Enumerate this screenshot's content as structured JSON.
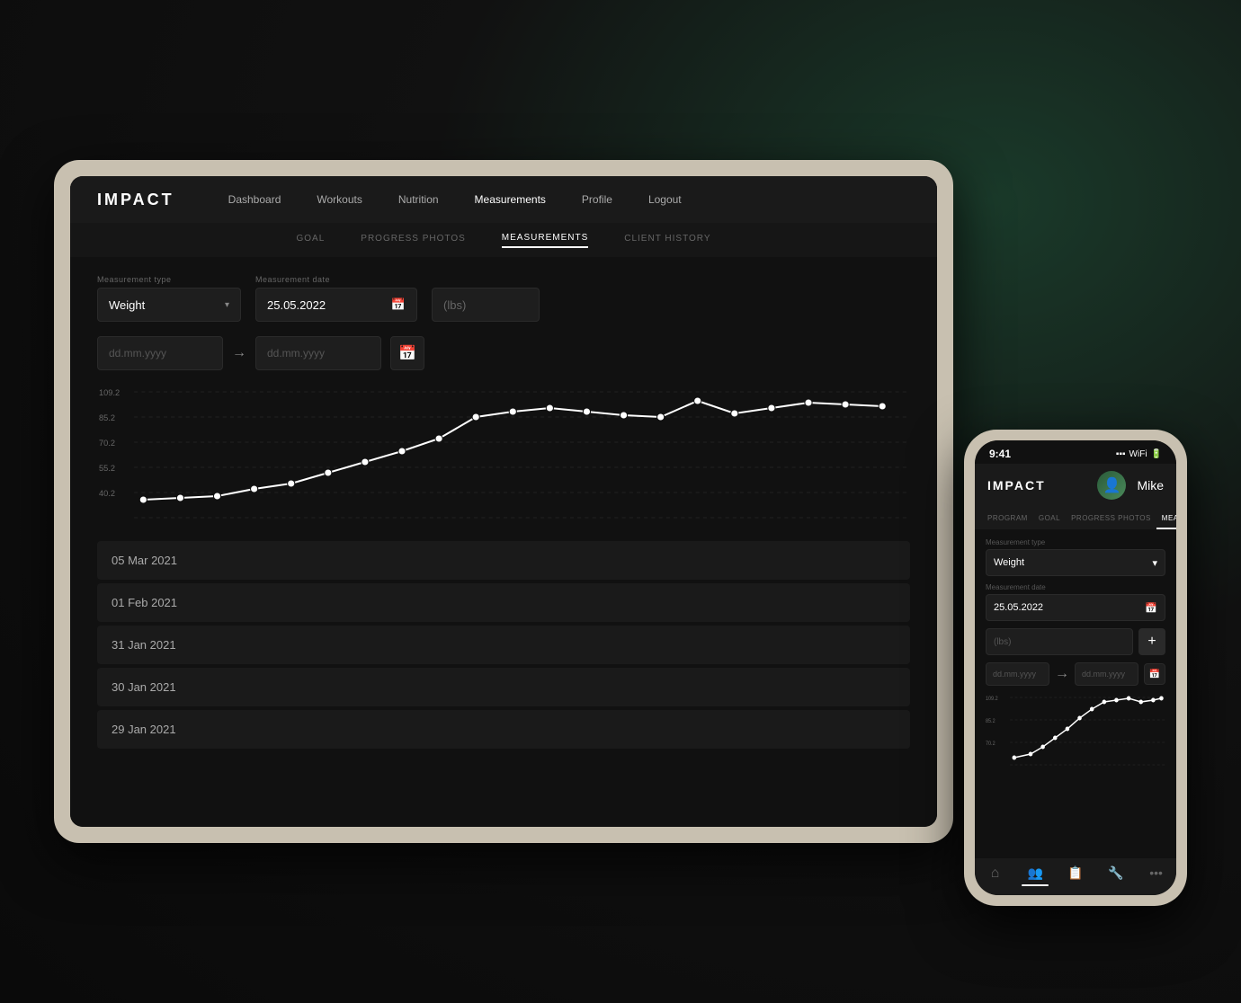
{
  "app": {
    "name": "IMPACT",
    "logo": "IMPACT"
  },
  "tablet": {
    "nav": {
      "items": [
        {
          "label": "Dashboard",
          "active": false
        },
        {
          "label": "Workouts",
          "active": false
        },
        {
          "label": "Nutrition",
          "active": false
        },
        {
          "label": "Measurements",
          "active": true
        },
        {
          "label": "Profile",
          "active": false
        },
        {
          "label": "Logout",
          "active": false
        }
      ]
    },
    "subnav": {
      "items": [
        {
          "label": "GOAL",
          "active": false
        },
        {
          "label": "PROGRESS PHOTOS",
          "active": false
        },
        {
          "label": "MEASUREMENTS",
          "active": true
        },
        {
          "label": "CLIENT HISTORY",
          "active": false
        }
      ]
    },
    "form": {
      "measurement_type_label": "Measurement type",
      "measurement_type_value": "Weight",
      "measurement_date_label": "Measurement date",
      "measurement_date_value": "25.05.2022",
      "unit_placeholder": "(lbs)",
      "date_from_placeholder": "dd.mm.yyyy",
      "date_to_placeholder": "dd.mm.yyyy"
    },
    "chart": {
      "y_labels": [
        "109.2",
        "85.2",
        "70.2",
        "55.2",
        "40.2"
      ],
      "color": "#ffffff"
    },
    "list": {
      "items": [
        {
          "date": "05 Mar 2021"
        },
        {
          "date": "01 Feb 2021"
        },
        {
          "date": "31 Jan 2021"
        },
        {
          "date": "30 Jan 2021"
        },
        {
          "date": "29 Jan 2021"
        }
      ]
    }
  },
  "phone": {
    "status_bar": {
      "time": "9:41",
      "signal": "▪▪▪",
      "wifi": "▾",
      "battery": "▮"
    },
    "user": {
      "name": "Mike"
    },
    "subnav": {
      "items": [
        {
          "label": "PROGRAM",
          "active": false
        },
        {
          "label": "GOAL",
          "active": false
        },
        {
          "label": "PROGRESS PHOTOS",
          "active": false
        },
        {
          "label": "MEASUREMENTS",
          "active": true
        }
      ]
    },
    "form": {
      "measurement_type_label": "Measurement type",
      "measurement_type_value": "Weight",
      "measurement_date_label": "Measurement date",
      "measurement_date_value": "25.05.2022",
      "unit_placeholder": "(lbs)",
      "add_button": "+",
      "date_from_placeholder": "dd.mm.yyyy",
      "date_to_placeholder": "dd.mm.yyyy"
    },
    "chart": {
      "y_labels": [
        "109.2",
        "85.2",
        "70.2"
      ],
      "color": "#ffffff"
    },
    "bottom_nav": {
      "items": [
        {
          "icon": "⌂",
          "label": "home",
          "active": false
        },
        {
          "icon": "👥",
          "label": "clients",
          "active": false
        },
        {
          "icon": "📋",
          "label": "clipboard",
          "active": false
        },
        {
          "icon": "🔧",
          "label": "tools",
          "active": false
        },
        {
          "icon": "•••",
          "label": "more",
          "active": false
        }
      ]
    }
  }
}
